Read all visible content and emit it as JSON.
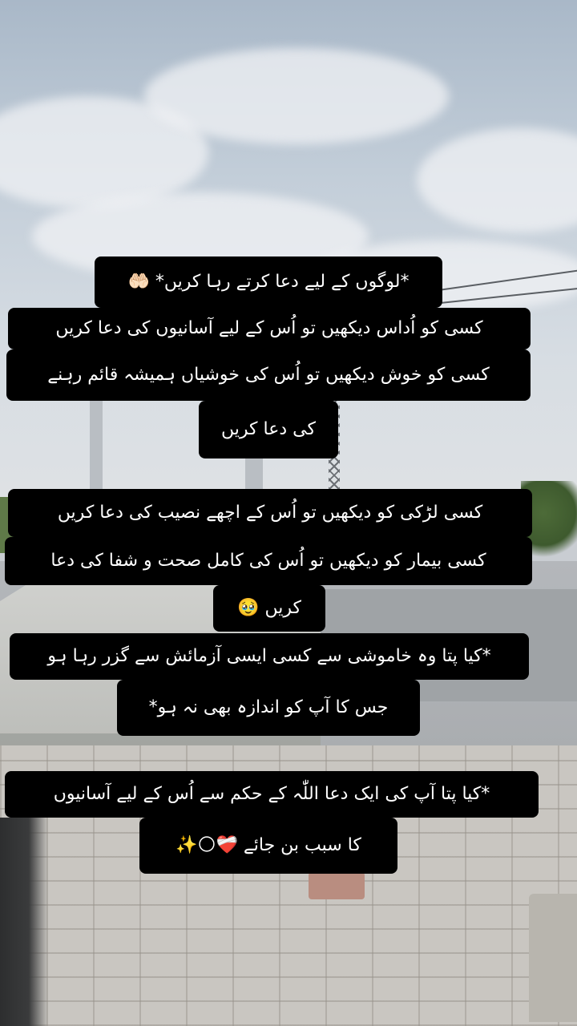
{
  "captions": [
    "*لوگوں کے لیے دعا کرتے رہا کریں* 🤲🏻",
    "کسی کو اُداس دیکھیں تو اُس کے لیے آسانیوں کی دعا کریں",
    "کسی کو خوش دیکھیں تو اُس کی خوشیاں ہمیشہ قائم رہنے",
    "کی دعا کریں",
    "کسی لڑکی کو دیکھیں تو اُس کے اچھے نصیب کی دعا کریں",
    "کسی بیمار کو دیکھیں تو اُس کی کامل صحت و شفا کی دعا",
    "کریں 🥹",
    "*کیا پتا وہ خاموشی سے کسی ایسی آزمائش سے گزر رہا ہو",
    "جس کا آپ کو اندازہ بھی نہ ہو*",
    "*کیا پتا آپ کی ایک دعا اللّٰہ کے حکم سے اُس کے لیے آسانیوں",
    "کا سبب بن جائے ❤️‍🩹🌕✨"
  ]
}
